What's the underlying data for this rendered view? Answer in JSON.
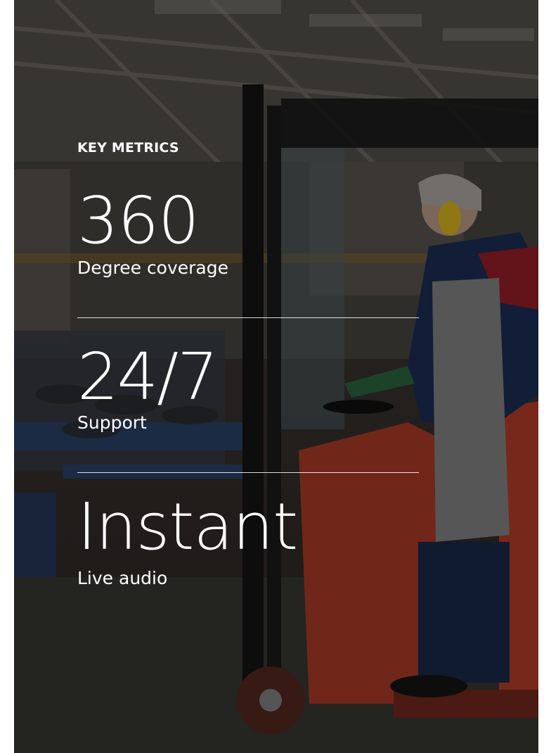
{
  "heading": "KEY METRICS",
  "metrics": [
    {
      "value": "360",
      "label": "Degree coverage"
    },
    {
      "value": "24/7",
      "label": "Support"
    },
    {
      "value": "Instant",
      "label": "Live audio"
    }
  ],
  "colors": {
    "text": "#ffffff",
    "overlay": "#000000",
    "forklift": "#c2412a",
    "earmuffs": "#e7c21f"
  },
  "icons": [
    "background-photo"
  ]
}
